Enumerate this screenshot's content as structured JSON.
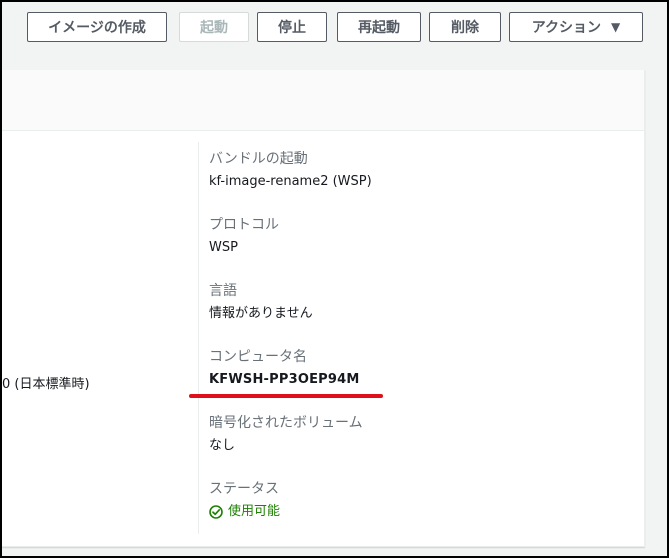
{
  "toolbar": {
    "create_image": "イメージの作成",
    "start": "起動",
    "stop": "停止",
    "restart": "再起動",
    "delete": "削除",
    "actions": "アクション",
    "actions_caret": "▼"
  },
  "left_column": {
    "timezone_fragment": "0 (日本標準時)"
  },
  "details": {
    "bundle": {
      "label": "バンドルの起動",
      "value": "kf-image-rename2 (WSP)"
    },
    "protocol": {
      "label": "プロトコル",
      "value": "WSP"
    },
    "language": {
      "label": "言語",
      "value": "情報がありません"
    },
    "computer_name": {
      "label": "コンピュータ名",
      "value": "KFWSH-PP3OEP94M"
    },
    "encrypted_volumes": {
      "label": "暗号化されたボリューム",
      "value": "なし"
    },
    "status": {
      "label": "ステータス",
      "value": "使用可能",
      "icon": "check-circle-icon",
      "color": "#1d8102"
    }
  },
  "annotation": {
    "underline_color": "#e0101a"
  }
}
